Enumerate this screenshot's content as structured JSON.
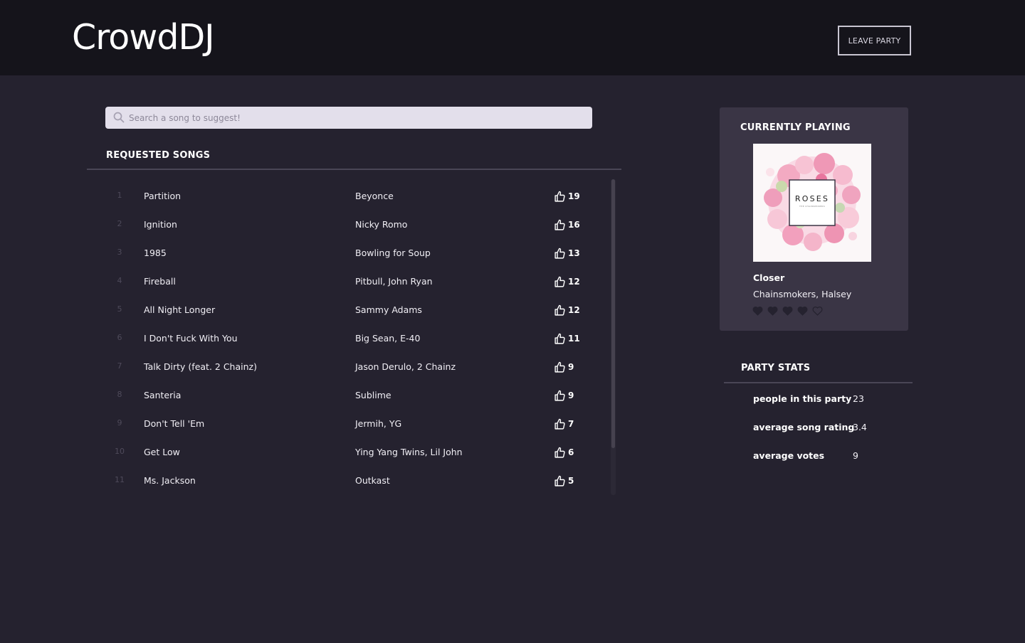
{
  "app": {
    "title": "CrowdDJ"
  },
  "header": {
    "leave_label": "LEAVE PARTY"
  },
  "search": {
    "placeholder": "Search a song to suggest!"
  },
  "requested": {
    "title": "REQUESTED SONGS",
    "songs": [
      {
        "num": "1",
        "title": "Partition",
        "artist": "Beyonce",
        "votes": "19"
      },
      {
        "num": "2",
        "title": "Ignition",
        "artist": "Nicky Romo",
        "votes": "16"
      },
      {
        "num": "3",
        "title": "1985",
        "artist": "Bowling for Soup",
        "votes": "13"
      },
      {
        "num": "4",
        "title": "Fireball",
        "artist": "Pitbull, John Ryan",
        "votes": "12"
      },
      {
        "num": "5",
        "title": "All Night Longer",
        "artist": "Sammy Adams",
        "votes": "12"
      },
      {
        "num": "6",
        "title": "I Don't Fuck With You",
        "artist": "Big Sean, E-40",
        "votes": "11"
      },
      {
        "num": "7",
        "title": "Talk Dirty (feat. 2 Chainz)",
        "artist": "Jason Derulo, 2 Chainz",
        "votes": "9"
      },
      {
        "num": "8",
        "title": "Santeria",
        "artist": "Sublime",
        "votes": "9"
      },
      {
        "num": "9",
        "title": "Don't Tell 'Em",
        "artist": "Jermih, YG",
        "votes": "7"
      },
      {
        "num": "10",
        "title": "Get Low",
        "artist": "Ying Yang Twins, Lil John",
        "votes": "6"
      },
      {
        "num": "11",
        "title": "Ms. Jackson",
        "artist": "Outkast",
        "votes": "5"
      }
    ]
  },
  "now_playing": {
    "title": "CURRENTLY PLAYING",
    "album_text": "ROSES",
    "album_subtext": "THE CHAINSMOKERS",
    "song": "Closer",
    "artist": "Chainsmokers, Halsey",
    "rating": 4,
    "rating_max": 5
  },
  "stats": {
    "title": "PARTY STATS",
    "items": [
      {
        "label": "people in this party",
        "value": "23"
      },
      {
        "label": "average song rating",
        "value": "3.4"
      },
      {
        "label": "average votes",
        "value": "9"
      }
    ]
  },
  "colors": {
    "background": "#25222f",
    "topbar": "#15141b",
    "card": "#3a3545",
    "search_bg": "#e3dfeb",
    "heart": "#25222f"
  }
}
